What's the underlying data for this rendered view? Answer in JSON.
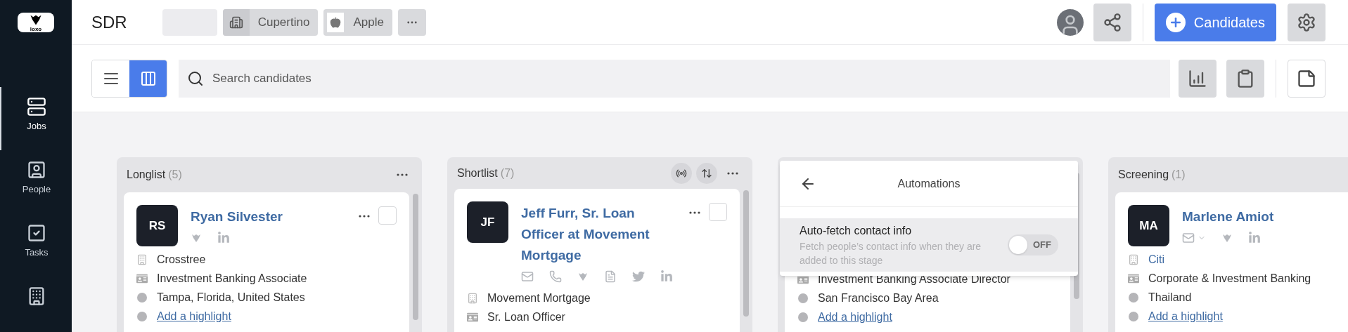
{
  "sidebar": {
    "logo": "loxo",
    "items": [
      {
        "label": "Jobs",
        "selected": true
      },
      {
        "label": "People",
        "selected": false
      },
      {
        "label": "Tasks",
        "selected": false
      },
      {
        "selected": false
      }
    ]
  },
  "header": {
    "title": "SDR",
    "chips": [
      {
        "kind": "blank"
      },
      {
        "kind": "location",
        "label": "Cupertino"
      },
      {
        "kind": "company",
        "label": "Apple"
      },
      {
        "kind": "more"
      }
    ],
    "add_button": "Candidates"
  },
  "toolbar": {
    "views": [
      {
        "kind": "list",
        "selected": false
      },
      {
        "kind": "board",
        "selected": true
      }
    ],
    "search": {
      "placeholder": "Search candidates"
    }
  },
  "columns": [
    {
      "title": "Longlist",
      "count": "(5)",
      "cards": [
        {
          "initials": "RS",
          "name": "Ryan Silvester",
          "checked": false,
          "contacts": [
            {
              "kind": "loxo"
            },
            {
              "kind": "linkedin"
            }
          ],
          "company": "Crosstree",
          "company_linked": false,
          "job_title": "Investment Banking Associate",
          "location": "Tampa, Florida, United States",
          "highlight": "Add a highlight"
        }
      ]
    },
    {
      "title": "Shortlist",
      "count": "(7)",
      "actions": [
        {
          "kind": "automation"
        },
        {
          "kind": "sort"
        }
      ],
      "cards": [
        {
          "initials": "JF",
          "name": "Jeff Furr, Sr. Loan Officer at Movement Mortgage",
          "checked": false,
          "contacts": [
            {
              "kind": "email"
            },
            {
              "kind": "phone"
            },
            {
              "kind": "loxo"
            },
            {
              "kind": "document"
            },
            {
              "kind": "twitter"
            },
            {
              "kind": "linkedin"
            }
          ],
          "company": "Movement Mortgage",
          "company_linked": false,
          "job_title": "Sr. Loan Officer"
        }
      ]
    },
    {
      "popup": {
        "title": "Automations",
        "setting": {
          "label": "Auto-fetch contact info",
          "description": "Fetch people’s contact info when they are added to this stage",
          "on": false,
          "state_label": "OFF"
        }
      },
      "cards": [
        {
          "job_title": "Investment Banking Associate Director",
          "location": "San Francisco Bay Area",
          "highlight": "Add a highlight"
        }
      ]
    },
    {
      "title": "Screening",
      "count": "(1)",
      "cards": [
        {
          "initials": "MA",
          "name": "Marlene Amiot",
          "contacts": [
            {
              "kind": "email-menu"
            },
            {
              "kind": "loxo"
            },
            {
              "kind": "linkedin"
            }
          ],
          "company": "Citi",
          "company_linked": true,
          "job_title": "Corporate & Investment Banking",
          "location": "Thailand",
          "highlight": "Add a highlight"
        }
      ]
    }
  ]
}
